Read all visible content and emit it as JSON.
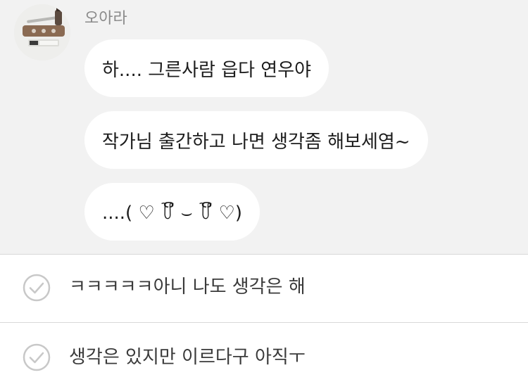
{
  "chat": {
    "sender_name": "오아라",
    "messages": [
      {
        "text": "하.... 그른사람 읍다 연우야"
      },
      {
        "text": "작가님 출간하고 나면 생각좀 해보세염~"
      },
      {
        "text": "....( ♡ ꒦ິ ⌣ ꒦ິ ♡)"
      }
    ]
  },
  "suggestions": [
    {
      "text": "ㅋㅋㅋㅋㅋ아니 나도 생각은 해",
      "icon": "check-circle-icon"
    },
    {
      "text": "생각은 있지만 이르다구 아직ㅜ",
      "icon": "check-circle-icon"
    }
  ],
  "colors": {
    "chat_background": "#f2f2f2",
    "bubble": "#ffffff",
    "sender_name": "#8a8a8a",
    "check_icon": "#c8c8c8",
    "divider": "#d8d8d8"
  }
}
